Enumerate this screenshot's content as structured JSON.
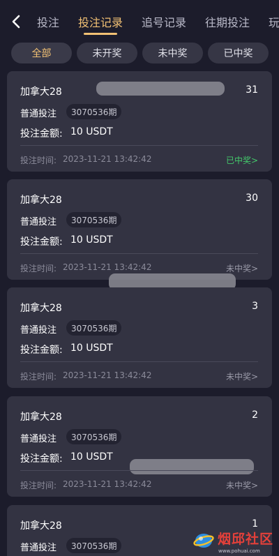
{
  "header": {
    "tabs": [
      {
        "label": "投注"
      },
      {
        "label": "投注记录"
      },
      {
        "label": "追号记录"
      },
      {
        "label": "往期投注"
      },
      {
        "label": "玩"
      }
    ],
    "active_tab": "投注记录"
  },
  "filters": [
    {
      "label": "全部"
    },
    {
      "label": "未开奖"
    },
    {
      "label": "未中奖"
    },
    {
      "label": "已中奖"
    }
  ],
  "active_filter": "全部",
  "card_labels": {
    "type": "普通投注",
    "amount_label": "投注金额:",
    "time_label": "投注时间:"
  },
  "bets": [
    {
      "game": "加拿大28",
      "number": "31",
      "period": "3070536期",
      "amount": "10 USDT",
      "time": "2023-11-21 13:42:42",
      "status": "已中奖>"
    },
    {
      "game": "加拿大28",
      "number": "30",
      "period": "3070536期",
      "amount": "10 USDT",
      "time": "2023-11-21 13:42:42",
      "status": "未中奖>"
    },
    {
      "game": "加拿大28",
      "number": "3",
      "period": "3070536期",
      "amount": "10 USDT",
      "time": "2023-11-21 13:42:42",
      "status": "未中奖>"
    },
    {
      "game": "加拿大28",
      "number": "2",
      "period": "3070536期",
      "amount": "10 USDT",
      "time": "2023-11-21 13:42:42",
      "status": "未中奖>"
    },
    {
      "game": "加拿大28",
      "number": "1",
      "period": "3070536期"
    }
  ],
  "watermark": {
    "text": "烟邱社区",
    "url": "www.pohuai.com"
  },
  "colors": {
    "background": "#1c1c2b",
    "card": "#333342",
    "accent": "#f2c174",
    "won": "#43c96b",
    "muted": "#8b8b9a"
  },
  "icons": {
    "back": "chevron-left-icon",
    "watermark_logo": "globe-swoosh-icon"
  }
}
